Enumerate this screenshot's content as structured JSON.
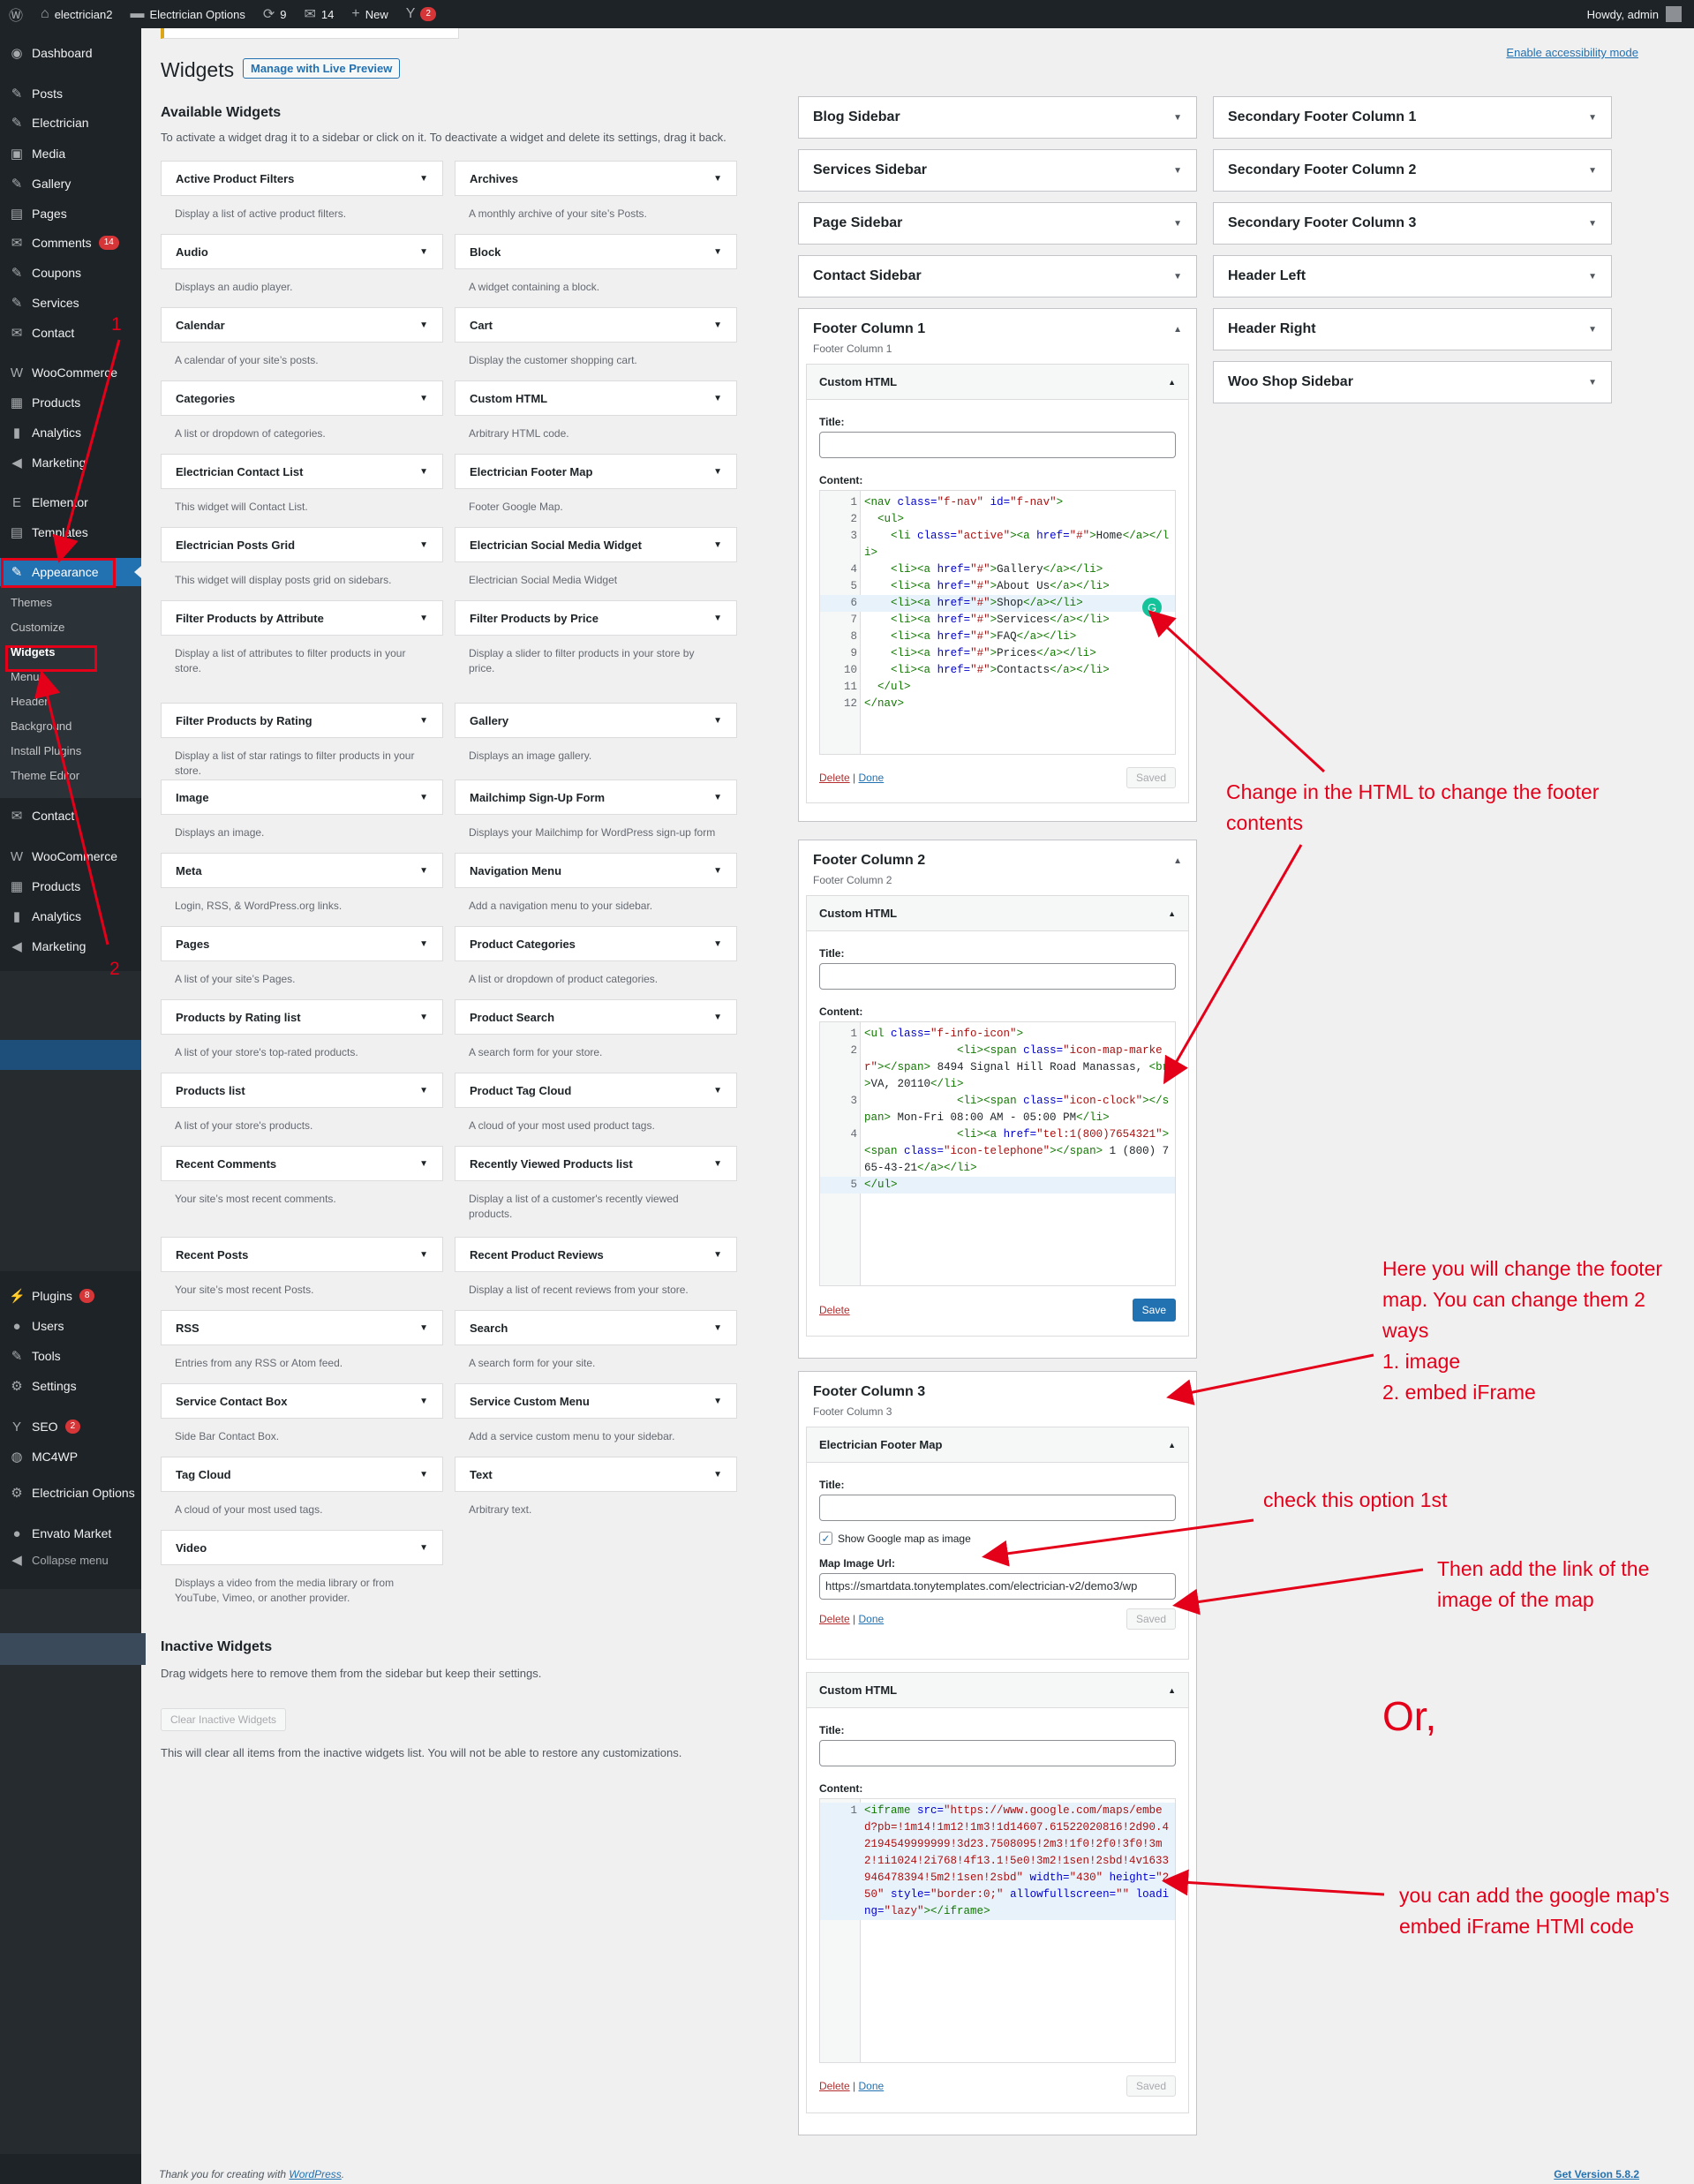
{
  "adminbar": {
    "site": "electrician2",
    "options": "Electrician Options",
    "updates": "9",
    "comments": "14",
    "new": "New",
    "yoast": "2",
    "howdy": "Howdy, admin"
  },
  "sidebar": {
    "top": [
      {
        "label": "Dashboard",
        "icon": "◉"
      },
      {
        "label": "Posts",
        "icon": "✎"
      },
      {
        "label": "Electrician",
        "icon": "✎"
      },
      {
        "label": "Media",
        "icon": "▣"
      },
      {
        "label": "Gallery",
        "icon": "✎"
      },
      {
        "label": "Pages",
        "icon": "▤"
      },
      {
        "label": "Comments",
        "icon": "✉",
        "badge": "14"
      },
      {
        "label": "Coupons",
        "icon": "✎"
      },
      {
        "label": "Services",
        "icon": "✎"
      },
      {
        "label": "Contact",
        "icon": "✉"
      },
      {
        "label": "WooCommerce",
        "icon": "W"
      },
      {
        "label": "Products",
        "icon": "▦"
      },
      {
        "label": "Analytics",
        "icon": "▮"
      },
      {
        "label": "Marketing",
        "icon": "◀"
      },
      {
        "label": "Elementor",
        "icon": "E"
      },
      {
        "label": "Templates",
        "icon": "▤"
      },
      {
        "label": "Appearance",
        "icon": "✎"
      }
    ],
    "sub": [
      "Themes",
      "Customize",
      "Widgets",
      "Menus",
      "Header",
      "Background",
      "Install Plugins",
      "Theme Editor"
    ],
    "mid": [
      {
        "label": "Contact",
        "icon": "✉"
      },
      {
        "label": "WooCommerce",
        "icon": "W"
      },
      {
        "label": "Products",
        "icon": "▦"
      },
      {
        "label": "Analytics",
        "icon": "▮"
      },
      {
        "label": "Marketing",
        "icon": "◀"
      }
    ],
    "bottom": [
      {
        "label": "Plugins",
        "icon": "⚡",
        "badge": "8"
      },
      {
        "label": "Users",
        "icon": "●"
      },
      {
        "label": "Tools",
        "icon": "✎"
      },
      {
        "label": "Settings",
        "icon": "⚙"
      },
      {
        "label": "SEO",
        "icon": "Y",
        "badge": "2"
      },
      {
        "label": "MC4WP",
        "icon": "◍"
      },
      {
        "label": "Electrician Options",
        "icon": "⚙"
      },
      {
        "label": "Envato Market",
        "icon": "●"
      }
    ],
    "collapse": "Collapse menu"
  },
  "page": {
    "title": "Widgets",
    "live_preview": "Manage with Live Preview",
    "accessibility": "Enable accessibility mode"
  },
  "available": {
    "title": "Available Widgets",
    "desc": "To activate a widget drag it to a sidebar or click on it. To deactivate a widget and delete its settings, drag it back.",
    "widgets": [
      {
        "name": "Active Product Filters",
        "desc": "Display a list of active product filters."
      },
      {
        "name": "Archives",
        "desc": "A monthly archive of your site’s Posts."
      },
      {
        "name": "Audio",
        "desc": "Displays an audio player."
      },
      {
        "name": "Block",
        "desc": "A widget containing a block."
      },
      {
        "name": "Calendar",
        "desc": "A calendar of your site’s posts."
      },
      {
        "name": "Cart",
        "desc": "Display the customer shopping cart."
      },
      {
        "name": "Categories",
        "desc": "A list or dropdown of categories."
      },
      {
        "name": "Custom HTML",
        "desc": "Arbitrary HTML code."
      },
      {
        "name": "Electrician Contact List",
        "desc": "This widget will Contact List."
      },
      {
        "name": "Electrician Footer Map",
        "desc": "Footer Google Map."
      },
      {
        "name": "Electrician Posts Grid",
        "desc": "This widget will display posts grid on sidebars."
      },
      {
        "name": "Electrician Social Media Widget",
        "desc": "Electrician Social Media Widget"
      },
      {
        "name": "Filter Products by Attribute",
        "desc": "Display a list of attributes to filter products in your store."
      },
      {
        "name": "Filter Products by Price",
        "desc": "Display a slider to filter products in your store by price."
      },
      {
        "name": "Filter Products by Rating",
        "desc": "Display a list of star ratings to filter products in your store."
      },
      {
        "name": "Gallery",
        "desc": "Displays an image gallery."
      },
      {
        "name": "Image",
        "desc": "Displays an image."
      },
      {
        "name": "Mailchimp Sign-Up Form",
        "desc": "Displays your Mailchimp for WordPress sign-up form"
      },
      {
        "name": "Meta",
        "desc": "Login, RSS, & WordPress.org links."
      },
      {
        "name": "Navigation Menu",
        "desc": "Add a navigation menu to your sidebar."
      },
      {
        "name": "Pages",
        "desc": "A list of your site’s Pages."
      },
      {
        "name": "Product Categories",
        "desc": "A list or dropdown of product categories."
      },
      {
        "name": "Products by Rating list",
        "desc": "A list of your store's top-rated products."
      },
      {
        "name": "Product Search",
        "desc": "A search form for your store."
      },
      {
        "name": "Products list",
        "desc": "A list of your store's products."
      },
      {
        "name": "Product Tag Cloud",
        "desc": "A cloud of your most used product tags."
      },
      {
        "name": "Recent Comments",
        "desc": "Your site’s most recent comments."
      },
      {
        "name": "Recently Viewed Products list",
        "desc": "Display a list of a customer's recently viewed products."
      },
      {
        "name": "Recent Posts",
        "desc": "Your site’s most recent Posts."
      },
      {
        "name": "Recent Product Reviews",
        "desc": "Display a list of recent reviews from your store."
      },
      {
        "name": "RSS",
        "desc": "Entries from any RSS or Atom feed."
      },
      {
        "name": "Search",
        "desc": "A search form for your site."
      },
      {
        "name": "Service Contact Box",
        "desc": "Side Bar Contact Box."
      },
      {
        "name": "Service Custom Menu",
        "desc": "Add a service custom menu to your sidebar."
      },
      {
        "name": "Tag Cloud",
        "desc": "A cloud of your most used tags."
      },
      {
        "name": "Text",
        "desc": "Arbitrary text."
      },
      {
        "name": "Video",
        "desc": "Displays a video from the media library or from YouTube, Vimeo, or another provider."
      }
    ]
  },
  "inactive": {
    "title": "Inactive Widgets",
    "desc": "Drag widgets here to remove them from the sidebar but keep their settings.",
    "clear": "Clear Inactive Widgets",
    "note": "This will clear all items from the inactive widgets list. You will not be able to restore any customizations."
  },
  "areas_col1": [
    "Blog Sidebar",
    "Services Sidebar",
    "Page Sidebar",
    "Contact Sidebar"
  ],
  "areas_col2": [
    "Secondary Footer Column 1",
    "Secondary Footer Column 2",
    "Secondary Footer Column 3",
    "Header Left",
    "Header Right",
    "Woo Shop Sidebar"
  ],
  "fc1": {
    "title": "Footer Column 1",
    "sub": "Footer Column 1",
    "widget": "Custom HTML",
    "title_label": "Title:",
    "content_label": "Content:",
    "delete": "Delete",
    "done": "Done",
    "saved": "Saved",
    "lines": [
      {
        "n": "1",
        "t": "<nav class=\"f-nav\" id=\"f-nav\">"
      },
      {
        "n": "2",
        "t": "  <ul>"
      },
      {
        "n": "3",
        "t": "    <li class=\"active\"><a href=\"#\">Home</a></li>"
      },
      {
        "n": "4",
        "t": "    <li><a href=\"#\">Gallery</a></li>"
      },
      {
        "n": "5",
        "t": "    <li><a href=\"#\">About Us</a></li>"
      },
      {
        "n": "6",
        "t": "    <li><a href=\"#\">Shop</a></li>"
      },
      {
        "n": "7",
        "t": "    <li><a href=\"#\">Services</a></li>"
      },
      {
        "n": "8",
        "t": "    <li><a href=\"#\">FAQ</a></li>"
      },
      {
        "n": "9",
        "t": "    <li><a href=\"#\">Prices</a></li>"
      },
      {
        "n": "10",
        "t": "    <li><a href=\"#\">Contacts</a></li>"
      },
      {
        "n": "11",
        "t": "  </ul>"
      },
      {
        "n": "12",
        "t": "</nav>"
      }
    ]
  },
  "fc2": {
    "title": "Footer Column 2",
    "sub": "Footer Column 2",
    "widget": "Custom HTML",
    "title_label": "Title:",
    "content_label": "Content:",
    "delete": "Delete",
    "save": "Save",
    "lines": [
      {
        "n": "1",
        "t": "<ul class=\"f-info-icon\">"
      },
      {
        "n": "2",
        "t": "              <li><span class=\"icon-map-marker\"></span> 8494 Signal Hill Road Manassas, <br>VA, 20110</li>"
      },
      {
        "n": "3",
        "t": "              <li><span class=\"icon-clock\"></span> Mon-Fri 08:00 AM - 05:00 PM</li>"
      },
      {
        "n": "4",
        "t": "              <li><a href=\"tel:1(800)7654321\"><span class=\"icon-telephone\"></span> 1 (800) 765-43-21</a></li>"
      },
      {
        "n": "5",
        "t": "</ul>"
      }
    ]
  },
  "fc3": {
    "title": "Footer Column 3",
    "sub": "Footer Column 3",
    "map": {
      "widget": "Electrician Footer Map",
      "title_label": "Title:",
      "checkbox": "Show Google map as image",
      "url_label": "Map Image Url:",
      "url": "https://smartdata.tonytemplates.com/electrician-v2/demo3/wp",
      "delete": "Delete",
      "done": "Done",
      "saved": "Saved"
    },
    "html": {
      "widget": "Custom HTML",
      "title_label": "Title:",
      "content_label": "Content:",
      "delete": "Delete",
      "done": "Done",
      "saved": "Saved",
      "lines": [
        {
          "n": "1",
          "t": "<iframe src=\"https://www.google.com/maps/embed?pb=!1m14!1m12!1m3!1d14607.61522020816!2d90.42194549999999!3d23.7508095!2m3!1f0!2f0!3f0!3m2!1i1024!2i768!4f13.1!5e0!3m2!1sen!2sbd!4v1633946478394!5m2!1sen!2sbd\" width=\"430\" height=\"250\" style=\"border:0;\" allowfullscreen=\"\" loading=\"lazy\"></iframe>"
        }
      ]
    }
  },
  "annotations": {
    "num1": "1",
    "num2": "2",
    "change_html": "Change in the HTML to change the footer contents",
    "footer_map": "Here you will change the footer map. You can change them 2 ways\n1. image\n2. embed iFrame",
    "check_option": "check this option 1st",
    "add_link": "Then add the link of the image of the map",
    "or": "Or,",
    "iframe": "you can add the google map's embed iFrame HTMl code"
  },
  "footer": {
    "thanks": "Thank you for creating with ",
    "wp": "WordPress",
    "thanks_end": ".",
    "version": "Get Version 5.8.2"
  }
}
